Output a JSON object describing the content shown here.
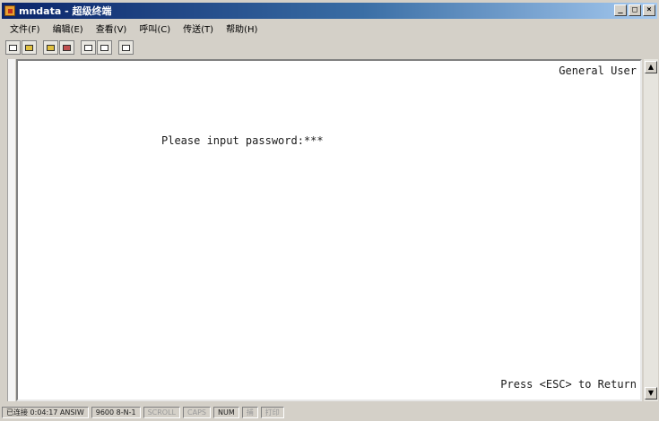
{
  "window": {
    "title": "mndata - 超级终端",
    "controls": {
      "minimize": "_",
      "maximize": "□",
      "close": "×"
    }
  },
  "menu": {
    "items": [
      "文件(F)",
      "编辑(E)",
      "查看(V)",
      "呼叫(C)",
      "传送(T)",
      "帮助(H)"
    ]
  },
  "toolbar": {
    "buttons": [
      {
        "icon": "new-icon"
      },
      {
        "icon": "open-icon"
      },
      {
        "icon": "connect-icon"
      },
      {
        "icon": "disconnect-icon"
      },
      {
        "icon": "send-icon"
      },
      {
        "icon": "receive-icon"
      },
      {
        "icon": "properties-icon"
      }
    ]
  },
  "terminal": {
    "user_label": "General User",
    "prompt": "Please input password:***",
    "footer": "Press <ESC> to Return"
  },
  "statusbar": {
    "cells": [
      {
        "text": "已连接 0:04:17 ANSIW",
        "dim": false
      },
      {
        "text": "9600 8-N-1",
        "dim": false
      },
      {
        "text": "SCROLL",
        "dim": true
      },
      {
        "text": "CAPS",
        "dim": true
      },
      {
        "text": "NUM",
        "dim": false
      },
      {
        "text": "捕",
        "dim": true
      },
      {
        "text": "打印",
        "dim": true
      }
    ]
  }
}
